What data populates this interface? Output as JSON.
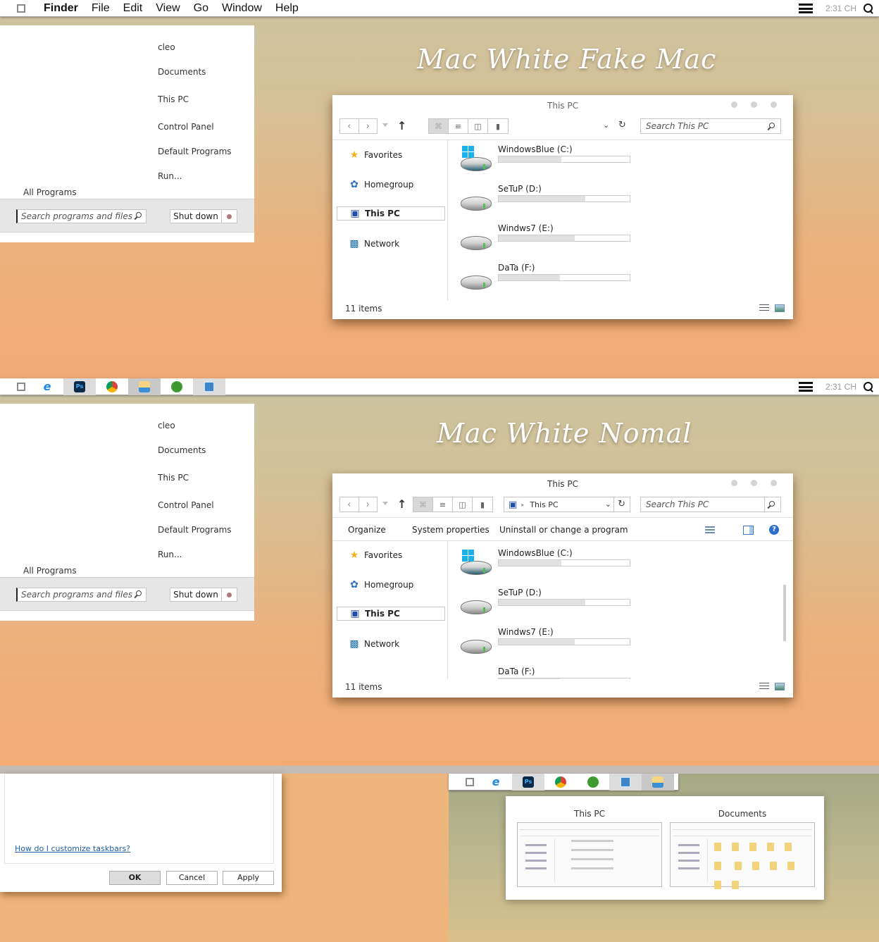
{
  "menubar": {
    "app_name": "Finder",
    "items": [
      "File",
      "Edit",
      "View",
      "Go",
      "Window",
      "Help"
    ],
    "clock": "2:31 CH"
  },
  "taskbar": {
    "clock": "2:31 CH",
    "apps": [
      {
        "name": "internet-explorer",
        "glyph": "e"
      },
      {
        "name": "photoshop",
        "glyph": "Ps"
      },
      {
        "name": "chrome",
        "glyph": ""
      },
      {
        "name": "file-explorer",
        "glyph": ""
      },
      {
        "name": "green-app",
        "glyph": ""
      },
      {
        "name": "remote-desktop",
        "glyph": ""
      }
    ]
  },
  "taskbar_bottom": {
    "apps": [
      {
        "name": "internet-explorer",
        "glyph": "e"
      },
      {
        "name": "photoshop",
        "glyph": "Ps"
      },
      {
        "name": "chrome",
        "glyph": ""
      },
      {
        "name": "green-app",
        "glyph": ""
      },
      {
        "name": "remote-desktop",
        "glyph": ""
      },
      {
        "name": "file-explorer",
        "glyph": ""
      }
    ]
  },
  "start_menu": {
    "right_items": [
      "cleo",
      "Documents",
      "This PC",
      "Control Panel",
      "Default Programs",
      "Run..."
    ],
    "all_programs": "All Programs",
    "search_placeholder": "Search programs and files",
    "shutdown_label": "Shut down"
  },
  "headings": {
    "top": "Mac White Fake Mac",
    "middle": "Mac White Nomal"
  },
  "explorer": {
    "title": "This PC",
    "search_placeholder": "Search This PC",
    "address": "This PC",
    "commands": [
      "Organize",
      "System properties",
      "Uninstall or change a program"
    ],
    "nav": [
      {
        "label": "Favorites",
        "icon": "star-icon"
      },
      {
        "label": "Homegroup",
        "icon": "homegroup-icon"
      },
      {
        "label": "This PC",
        "icon": "computer-icon",
        "selected": true
      },
      {
        "label": "Network",
        "icon": "network-icon"
      }
    ],
    "drives": [
      {
        "label": "WindowsBlue (C:)",
        "used_fraction": 0.48,
        "system": true
      },
      {
        "label": "SeTuP (D:)",
        "used_fraction": 0.66,
        "system": false
      },
      {
        "label": "Windws7 (E:)",
        "used_fraction": 0.58,
        "system": false
      },
      {
        "label": "DaTa (F:)",
        "used_fraction": 0.47,
        "system": false
      }
    ],
    "status": "11 items"
  },
  "dialog": {
    "help_link": "How do I customize taskbars?",
    "ok": "OK",
    "cancel": "Cancel",
    "apply": "Apply"
  },
  "thumbnails": {
    "items": [
      {
        "title": "This PC"
      },
      {
        "title": "Documents"
      }
    ]
  },
  "colors": {
    "drive_fill": "#e1e1e1",
    "link": "#1e5fa8",
    "win_logo": "#1ab1ea",
    "shutdown_dot": "#b5787a"
  }
}
